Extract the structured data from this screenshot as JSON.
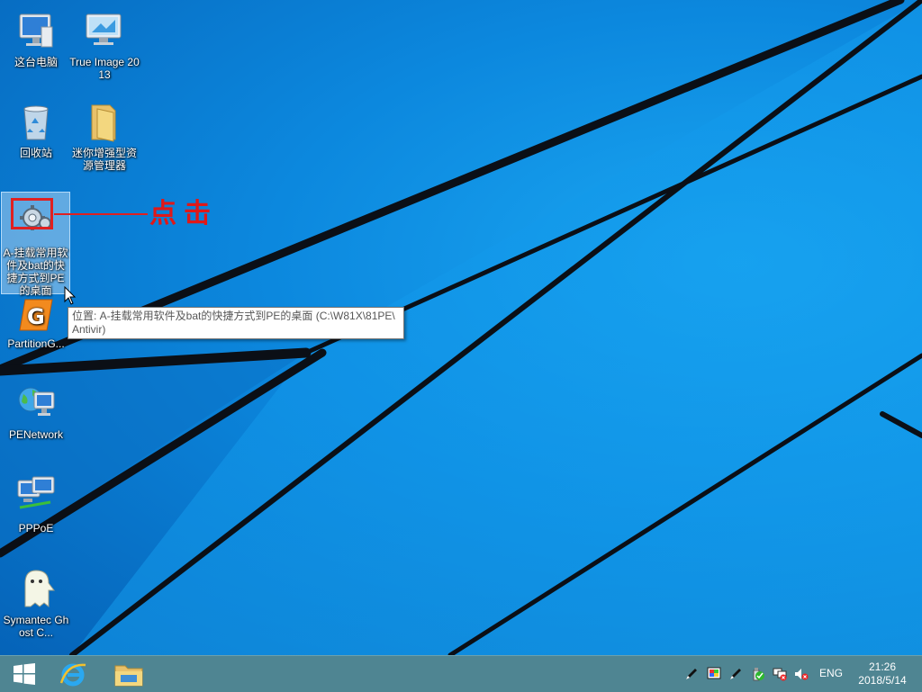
{
  "desktop": {
    "icons": [
      {
        "label": "这台电脑",
        "icon": "computer-icon"
      },
      {
        "label": "True Image 2013",
        "icon": "true-image-icon"
      },
      {
        "label": "回收站",
        "icon": "recycle-bin-icon"
      },
      {
        "label": "迷你增强型资源管理器",
        "icon": "folder-icon"
      },
      {
        "label": "A-挂载常用软件及bat的快捷方式到PE的桌面",
        "icon": "gear-shortcut-icon"
      },
      {
        "label": "PartitionG...",
        "icon": "partition-guru-icon"
      },
      {
        "label": "PENetwork",
        "icon": "network-globe-icon"
      },
      {
        "label": "PPPoE",
        "icon": "pppoe-icon"
      },
      {
        "label": "Symantec Ghost C...",
        "icon": "ghost-icon"
      }
    ]
  },
  "annotation": {
    "text": "点击",
    "color": "#e02020"
  },
  "tooltip": {
    "line1": "位置: A-挂载常用软件及bat的快捷方式到PE的桌面 (C:\\W81X\\81PE\\",
    "line2": "Antivir)"
  },
  "taskbar": {
    "start": "windows-start-icon",
    "pinned": [
      "internet-explorer-icon",
      "file-explorer-icon"
    ],
    "tray": [
      "pen-icon",
      "display-color-icon",
      "pen-icon-2",
      "usb-drive-icon",
      "security-shield-icon",
      "network-disconnected-icon",
      "volume-muted-icon"
    ],
    "language": "ENG",
    "time": "21:26",
    "date": "2018/5/14"
  },
  "colors": {
    "taskbar": "#4f8592",
    "wallpaper": "#0c88de",
    "accent_red": "#e02020"
  }
}
